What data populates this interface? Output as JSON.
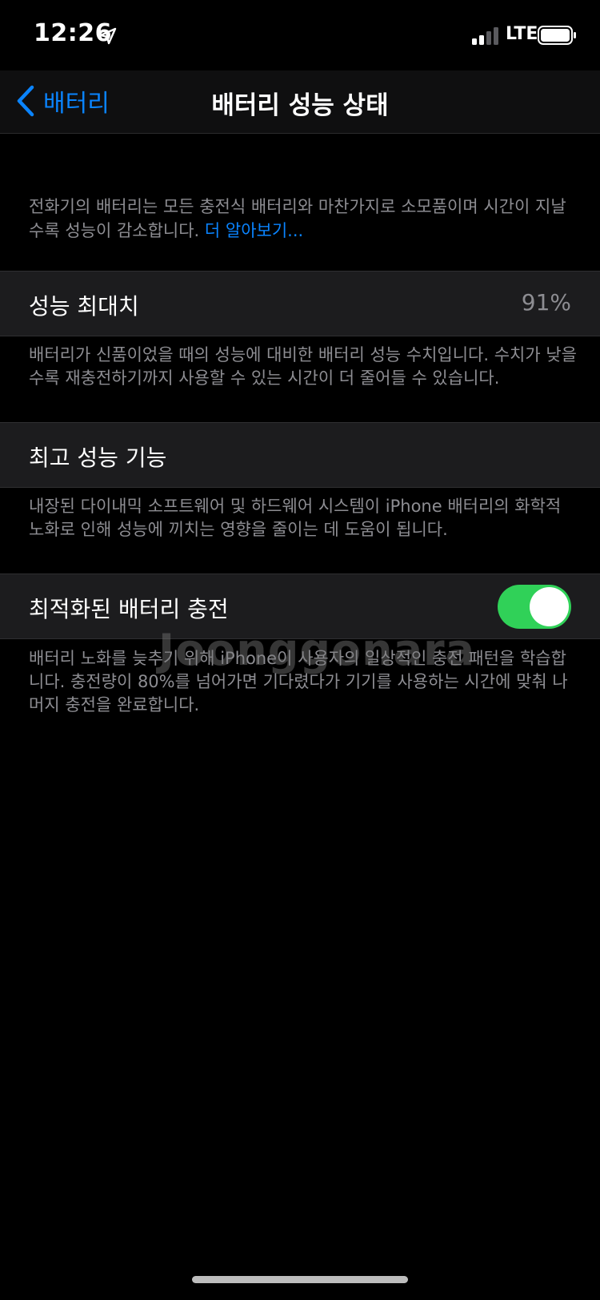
{
  "status_bar": {
    "time": "12:26",
    "network": "LTE",
    "icons": [
      "location-arrow-icon",
      "signal-bars-icon",
      "battery-icon"
    ]
  },
  "nav": {
    "back_label": "배터리",
    "title": "배터리 성능 상태"
  },
  "intro": {
    "text": "전화기의 배터리는 모든 충전식 배터리와 마찬가지로 소모품이며 시간이 지날수록 성능이 감소합니다. ",
    "link": "더 알아보기..."
  },
  "max_capacity": {
    "label": "성능 최대치",
    "value": "91%",
    "footer": "배터리가 신품이었을 때의 성능에 대비한 배터리 성능 수치입니다. 수치가 낮을수록 재충전하기까지 사용할 수 있는 시간이 더 줄어들 수 있습니다."
  },
  "peak_performance": {
    "label": "최고 성능 기능",
    "footer": "내장된 다이내믹 소프트웨어 및 하드웨어 시스템이 iPhone 배터리의 화학적 노화로 인해 성능에 끼치는 영향을 줄이는 데 도움이 됩니다."
  },
  "optimized_charging": {
    "label": "최적화된 배터리 충전",
    "enabled": true,
    "footer": "배터리 노화를 늦추기 위해 iPhone이 사용자의 일상적인 충전 패턴을 학습합니다. 충전량이 80%를 넘어가면 기다렸다가 기기를 사용하는 시간에 맞춰 나머지 충전을 완료합니다."
  },
  "watermark": "Joonggonara",
  "colors": {
    "accent": "#0a84ff",
    "toggle_on": "#30d158",
    "cell_bg": "#1c1c1e",
    "secondary_text": "#8d8d92"
  }
}
